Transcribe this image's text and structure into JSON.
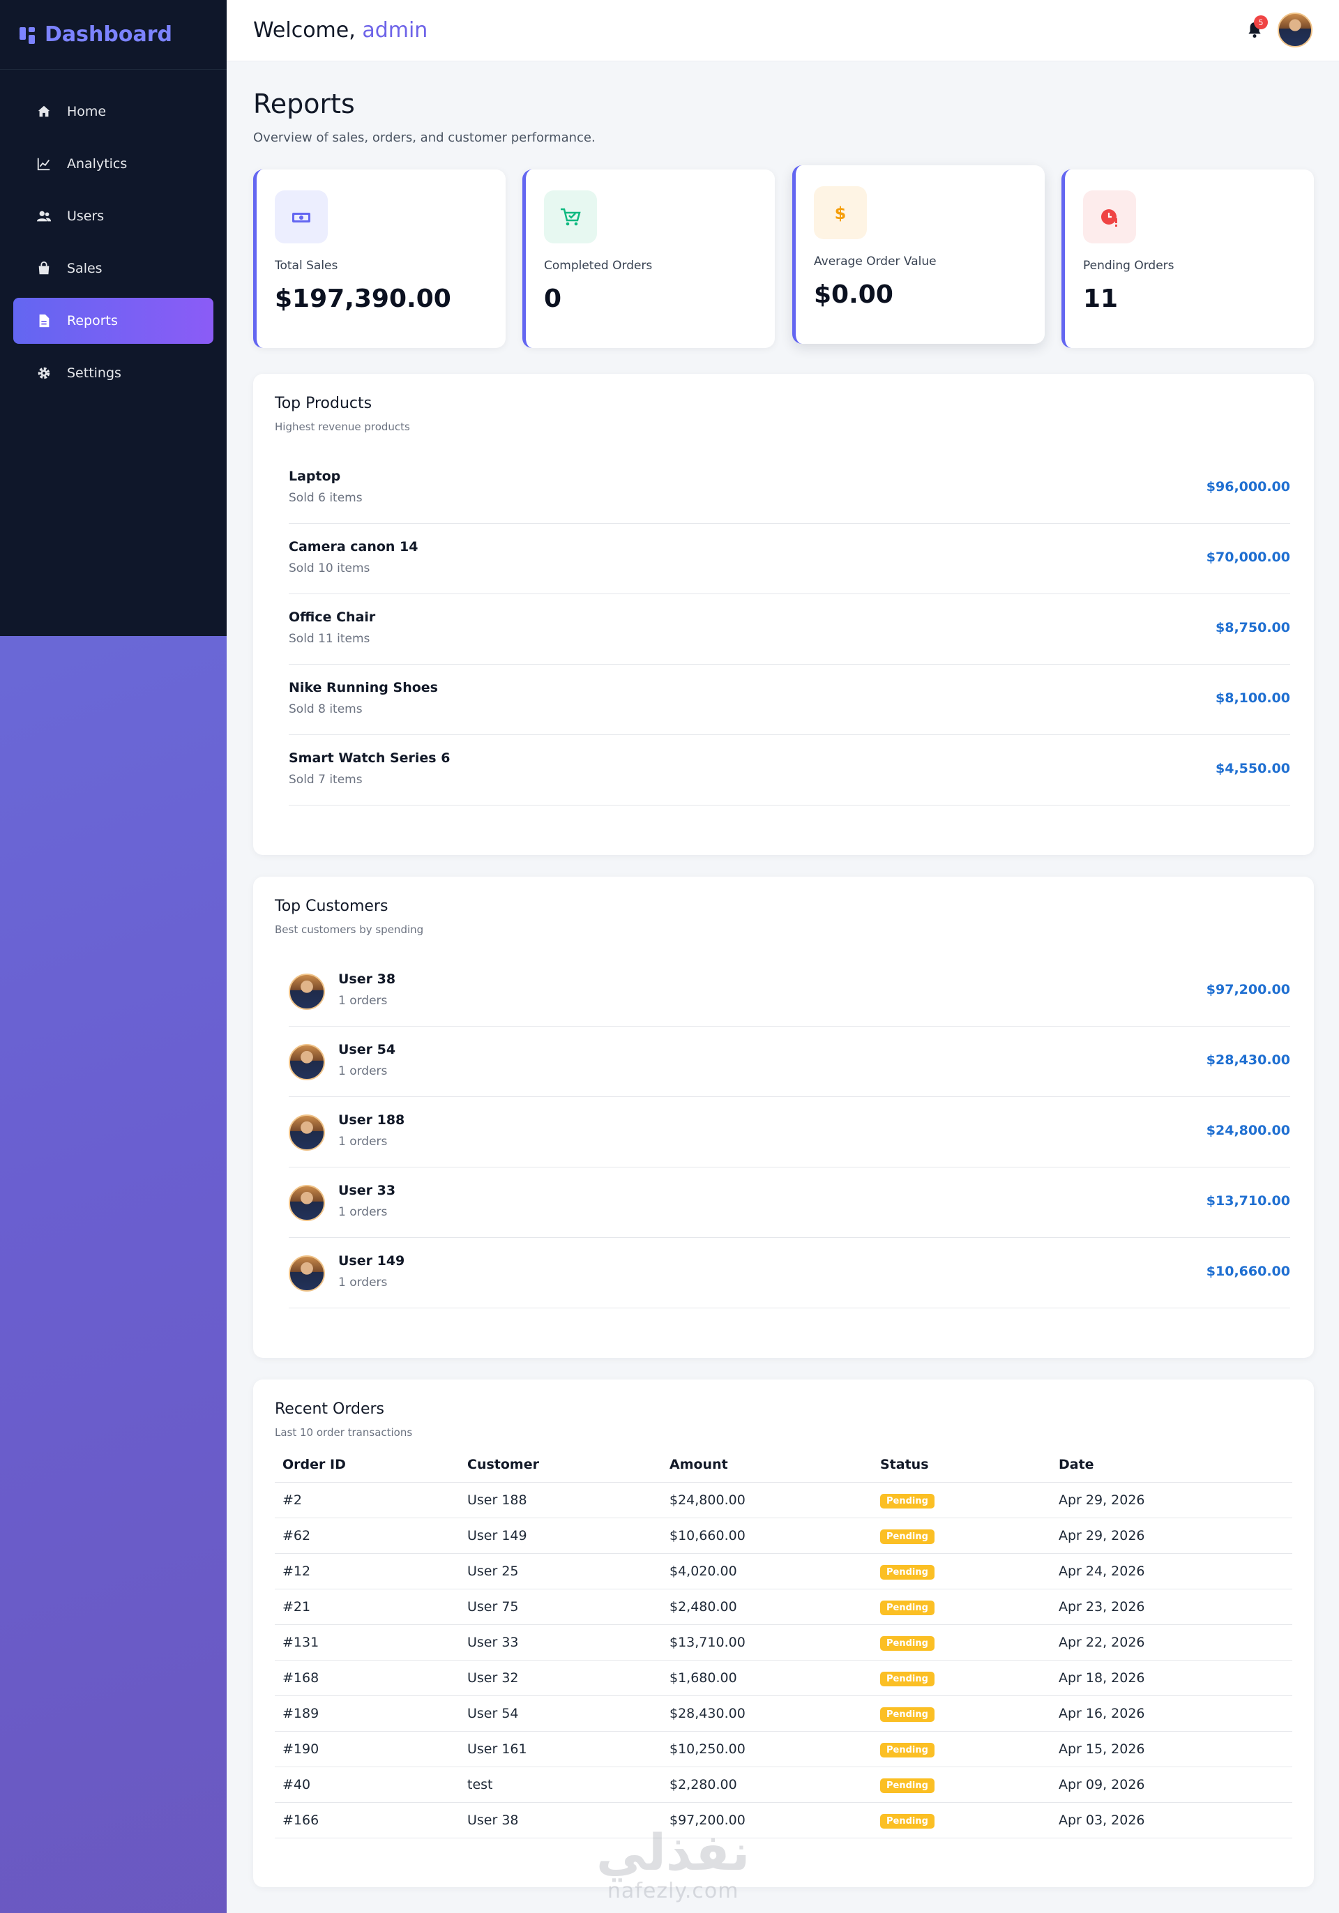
{
  "sidebar": {
    "brand": "Dashboard",
    "items": [
      {
        "label": "Home",
        "icon": "home-icon"
      },
      {
        "label": "Analytics",
        "icon": "chart-line-icon"
      },
      {
        "label": "Users",
        "icon": "users-icon"
      },
      {
        "label": "Sales",
        "icon": "shopping-bag-icon"
      },
      {
        "label": "Reports",
        "icon": "file-icon",
        "active": true
      },
      {
        "label": "Settings",
        "icon": "gear-icon"
      }
    ]
  },
  "topbar": {
    "welcome": "Welcome,",
    "username": "admin",
    "notifications": "5"
  },
  "page": {
    "title": "Reports",
    "subtitle": "Overview of sales, orders, and customer performance."
  },
  "stats": [
    {
      "label": "Total Sales",
      "value": "$197,390.00",
      "icon": "money-icon",
      "color": "#6366f1"
    },
    {
      "label": "Completed Orders",
      "value": "0",
      "icon": "cart-check-icon",
      "color": "#10b981"
    },
    {
      "label": "Average Order Value",
      "value": "$0.00",
      "icon": "dollar-icon",
      "color": "#f59e0b"
    },
    {
      "label": "Pending Orders",
      "value": "11",
      "icon": "clock-alert-icon",
      "color": "#ef4444"
    }
  ],
  "top_products": {
    "title": "Top Products",
    "subtitle": "Highest revenue products",
    "items": [
      {
        "name": "Laptop",
        "meta": "Sold 6 items",
        "amount": "$96,000.00"
      },
      {
        "name": "Camera canon 14",
        "meta": "Sold 10 items",
        "amount": "$70,000.00"
      },
      {
        "name": "Office Chair",
        "meta": "Sold 11 items",
        "amount": "$8,750.00"
      },
      {
        "name": "Nike Running Shoes",
        "meta": "Sold 8 items",
        "amount": "$8,100.00"
      },
      {
        "name": "Smart Watch Series 6",
        "meta": "Sold 7 items",
        "amount": "$4,550.00"
      }
    ]
  },
  "top_customers": {
    "title": "Top Customers",
    "subtitle": "Best customers by spending",
    "items": [
      {
        "name": "User 38",
        "meta": "1 orders",
        "amount": "$97,200.00"
      },
      {
        "name": "User 54",
        "meta": "1 orders",
        "amount": "$28,430.00"
      },
      {
        "name": "User 188",
        "meta": "1 orders",
        "amount": "$24,800.00"
      },
      {
        "name": "User 33",
        "meta": "1 orders",
        "amount": "$13,710.00"
      },
      {
        "name": "User 149",
        "meta": "1 orders",
        "amount": "$10,660.00"
      }
    ]
  },
  "recent_orders": {
    "title": "Recent Orders",
    "subtitle": "Last 10 order transactions",
    "columns": [
      "Order ID",
      "Customer",
      "Amount",
      "Status",
      "Date"
    ],
    "rows": [
      [
        "#2",
        "User 188",
        "$24,800.00",
        "Pending",
        "Apr 29, 2026"
      ],
      [
        "#62",
        "User 149",
        "$10,660.00",
        "Pending",
        "Apr 29, 2026"
      ],
      [
        "#12",
        "User 25",
        "$4,020.00",
        "Pending",
        "Apr 24, 2026"
      ],
      [
        "#21",
        "User 75",
        "$2,480.00",
        "Pending",
        "Apr 23, 2026"
      ],
      [
        "#131",
        "User 33",
        "$13,710.00",
        "Pending",
        "Apr 22, 2026"
      ],
      [
        "#168",
        "User 32",
        "$1,680.00",
        "Pending",
        "Apr 18, 2026"
      ],
      [
        "#189",
        "User 54",
        "$28,430.00",
        "Pending",
        "Apr 16, 2026"
      ],
      [
        "#190",
        "User 161",
        "$10,250.00",
        "Pending",
        "Apr 15, 2026"
      ],
      [
        "#40",
        "test",
        "$2,280.00",
        "Pending",
        "Apr 09, 2026"
      ],
      [
        "#166",
        "User 38",
        "$97,200.00",
        "Pending",
        "Apr 03, 2026"
      ]
    ]
  },
  "watermark": {
    "arabic": "نفذلي",
    "latin": "nafezly.com"
  }
}
